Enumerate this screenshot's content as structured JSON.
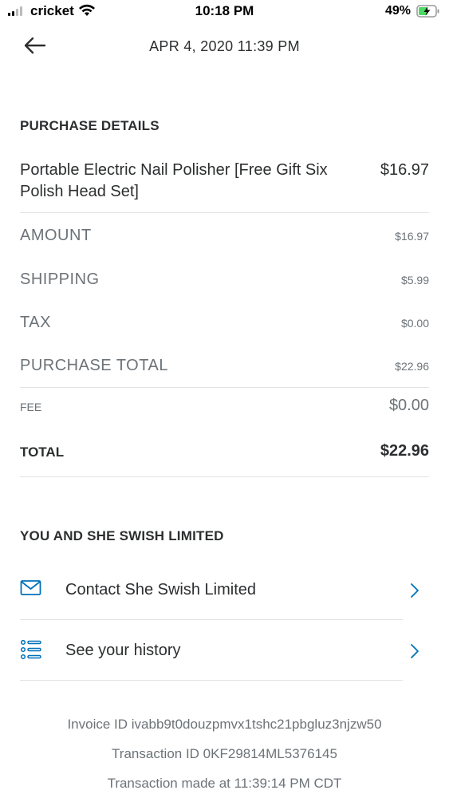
{
  "status_bar": {
    "carrier": "cricket",
    "time": "10:18 PM",
    "battery": "49%"
  },
  "header": {
    "date": "APR 4, 2020  11:39 PM"
  },
  "purchase": {
    "title": "PURCHASE DETAILS",
    "item_name": "Portable Electric Nail Polisher [Free Gift Six Polish Head Set]",
    "item_price": "$16.97",
    "rows": [
      {
        "label": "AMOUNT",
        "value": "$16.97"
      },
      {
        "label": "SHIPPING",
        "value": "$5.99"
      },
      {
        "label": "TAX",
        "value": "$0.00"
      },
      {
        "label": "PURCHASE TOTAL",
        "value": "$22.96"
      }
    ],
    "fee_label": "FEE",
    "fee_value": "$0.00",
    "total_label": "TOTAL",
    "total_value": "$22.96"
  },
  "merchant": {
    "title": "YOU AND SHE SWISH LIMITED",
    "contact_label": "Contact She Swish Limited",
    "history_label": "See your history"
  },
  "footer": {
    "invoice": "Invoice ID ivabb9t0douzpmvx1tshc21pbgluz3njzw50",
    "transaction": "Transaction ID 0KF29814ML5376145",
    "made_at": "Transaction made at 11:39:14 PM CDT"
  },
  "colors": {
    "accent": "#0070ba",
    "text": "#2c2e2f",
    "muted": "#6c7378",
    "divider": "#e3e3e3"
  }
}
